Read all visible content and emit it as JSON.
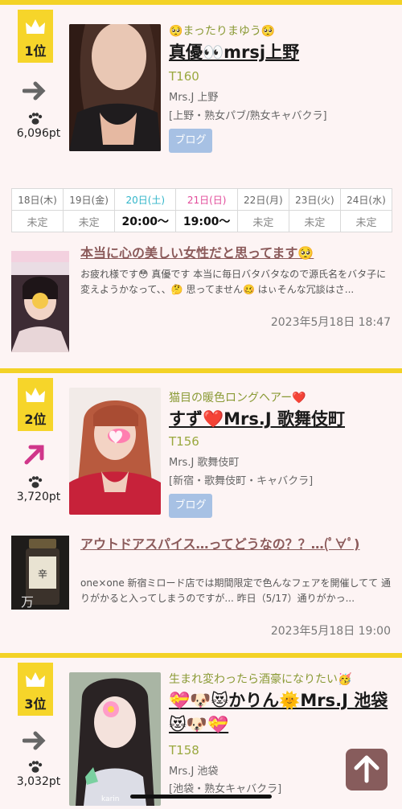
{
  "colors": {
    "gold": "#f3d226",
    "card_bg": "#fdf4f4",
    "catch": "#8a9a35",
    "blog_title": "#8b5a5a",
    "sat": "#30b5c9",
    "sun": "#e24b9a"
  },
  "rankings": [
    {
      "rank": "1位",
      "trend_icon": "arrow-right-icon",
      "points": "6,096pt",
      "catchphrase": "🥺まったりまゆう🥺",
      "name": "真優👀mrsj上野",
      "height": "T160",
      "shop": "Mrs.J 上野",
      "genre": "[上野・熟女パブ/熟女キャバクラ]",
      "blog_button": "ブログ",
      "schedule": {
        "days": [
          "18日(木)",
          "19日(金)",
          "20日(土)",
          "21日(日)",
          "22日(月)",
          "23日(火)",
          "24日(水)"
        ],
        "values": [
          "未定",
          "未定",
          "20:00〜",
          "19:00〜",
          "未定",
          "未定",
          "未定"
        ]
      },
      "blog": {
        "title": "本当に心の美しい女性だと思ってます🥺",
        "excerpt": "お疲れ様です😳 真優です 本当に毎日バタバタなので源氏名をバタ子に変えようかなって、、🤔 思ってません🥴 はぃそんな冗談はさ...",
        "date": "2023年5月18日 18:47"
      }
    },
    {
      "rank": "2位",
      "trend_icon": "arrow-up-right-icon",
      "points": "3,720pt",
      "catchphrase": "猫目の暖色ロングヘアー❤️",
      "name": "すず❤️Mrs.J 歌舞伎町",
      "height": "T156",
      "shop": "Mrs.J 歌舞伎町",
      "genre": "[新宿・歌舞伎町・キャバクラ]",
      "blog_button": "ブログ",
      "blog": {
        "title": "アウトドアスパイス…ってどうなの？？…(ﾟ∀ﾟ)",
        "excerpt": "one×one 新宿ミロード店では期間限定で色んなフェアを開催してて 通りがかると入ってしまうのですが... 昨日（5/17）通りがかっ...",
        "date": "2023年5月18日 19:00"
      }
    },
    {
      "rank": "3位",
      "trend_icon": "arrow-right-icon",
      "points": "3,032pt",
      "catchphrase": "生まれ変わったら酒豪になりたい🥳",
      "name": "💝🐶😻かりん🌞Mrs.J 池袋😻🐶💝",
      "height": "T158",
      "shop": "Mrs.J 池袋",
      "genre": "[池袋・熟女キャバクラ]"
    }
  ]
}
